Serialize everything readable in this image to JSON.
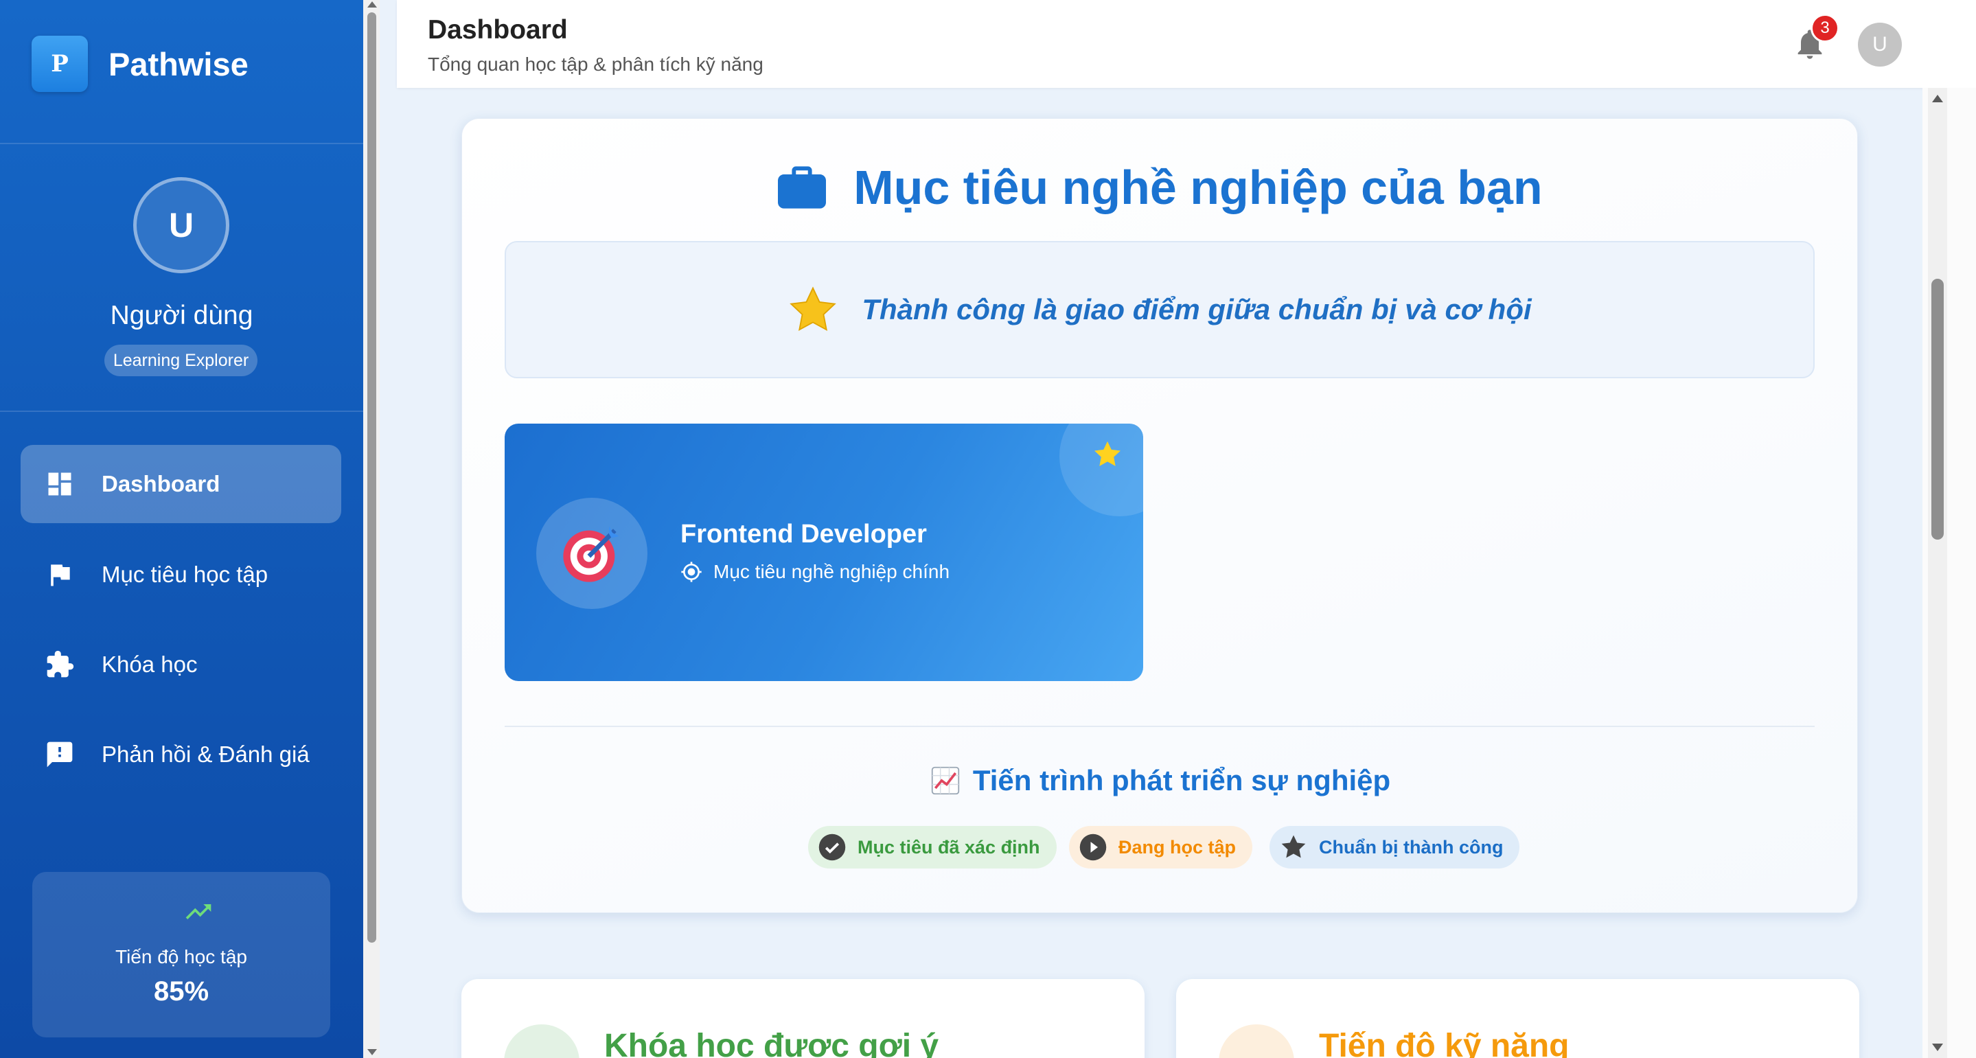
{
  "brand": {
    "logo_letter": "P",
    "name": "Pathwise"
  },
  "user": {
    "initial": "U",
    "name": "Người dùng",
    "badge": "Learning Explorer"
  },
  "nav": {
    "items": [
      {
        "label": "Dashboard",
        "icon": "dashboard-icon",
        "active": true
      },
      {
        "label": "Mục tiêu học tập",
        "icon": "flag-icon",
        "active": false
      },
      {
        "label": "Khóa học",
        "icon": "puzzle-icon",
        "active": false
      },
      {
        "label": "Phản hồi & Đánh giá",
        "icon": "feedback-icon",
        "active": false
      }
    ]
  },
  "sidebar_progress": {
    "label": "Tiến độ học tập",
    "value": "85%",
    "percent": 85
  },
  "header": {
    "title": "Dashboard",
    "subtitle": "Tổng quan học tập & phân tích kỹ năng",
    "notification_count": "3",
    "avatar_initial": "U"
  },
  "career": {
    "heading": "Mục tiêu nghề nghiệp của bạn",
    "quote": "Thành công là giao điểm giữa chuẩn bị và cơ hội",
    "goal": {
      "title": "Frontend Developer",
      "subtitle": "Mục tiêu nghề nghiệp chính"
    },
    "progress_heading": "Tiến trình phát triển sự nghiệp",
    "steps": [
      {
        "label": "Mục tiêu đã xác định",
        "color": "#3a9a3f"
      },
      {
        "label": "Đang học tập",
        "color": "#f28a00"
      },
      {
        "label": "Chuẩn bị thành công",
        "color": "#1b6ec6"
      }
    ]
  },
  "cards": {
    "recommended_courses": {
      "title": "Khóa học được gợi ý"
    },
    "skill_progress": {
      "title": "Tiến độ kỹ năng"
    }
  },
  "colors": {
    "sidebar": "#1157b5",
    "accent": "#1b73d1",
    "badge": "#e02424"
  }
}
